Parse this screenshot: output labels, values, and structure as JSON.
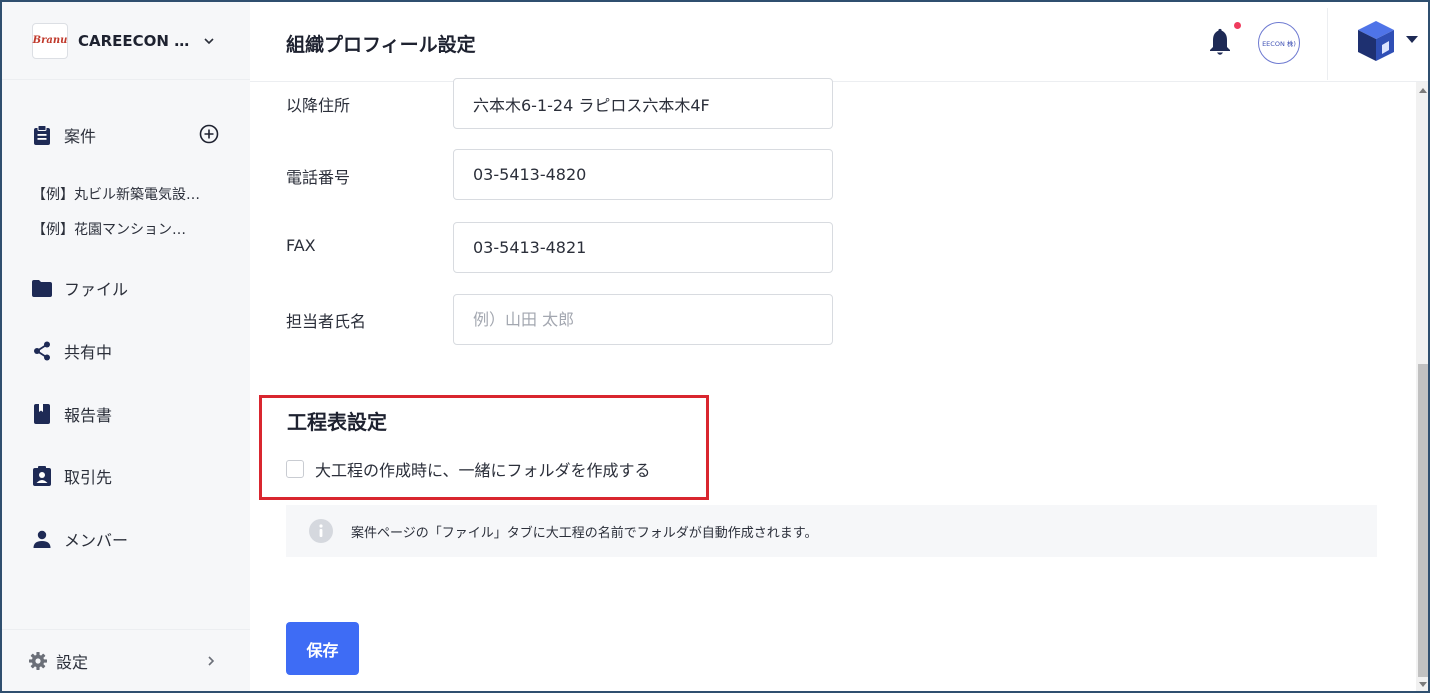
{
  "sidebar": {
    "org_logo_text": "Branu",
    "org_name": "CAREECON 施…",
    "nav": {
      "projects": "案件",
      "files": "ファイル",
      "shared": "共有中",
      "reports": "報告書",
      "clients": "取引先",
      "members": "メンバー"
    },
    "project_items": [
      "【例】丸ビル新築電気設…",
      "【例】花園マンション…"
    ],
    "settings_label": "設定"
  },
  "header": {
    "title": "組織プロフィール設定",
    "company_avatar_text": "EECON 株)",
    "notification_dot_color": "#ef3b5d"
  },
  "form": {
    "address_label": "以降住所",
    "address_value": "六本木6-1-24 ラピロス六本木4F",
    "phone_label": "電話番号",
    "phone_value": "03-5413-4820",
    "fax_label": "FAX",
    "fax_value": "03-5413-4821",
    "contact_label": "担当者氏名",
    "contact_placeholder": "例）山田 太郎",
    "contact_value": ""
  },
  "schedule": {
    "title": "工程表設定",
    "checkbox_label": "大工程の作成時に、一緒にフォルダを作成する",
    "checked": false,
    "info_text": "案件ページの「ファイル」タブに大工程の名前でフォルダが自動作成されます。"
  },
  "save_label": "保存",
  "colors": {
    "accent": "#3e6cf5",
    "highlight": "#d9262f"
  }
}
